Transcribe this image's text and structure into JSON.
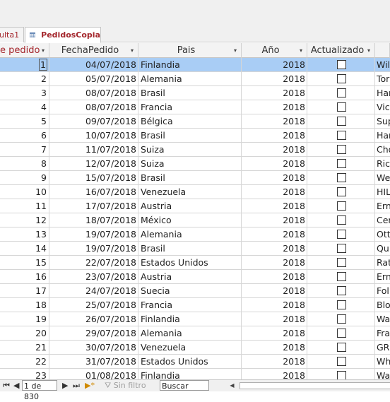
{
  "tabs": [
    {
      "label": "ulta1"
    },
    {
      "label": "PedidosCopia"
    }
  ],
  "columns": {
    "id": "e pedido",
    "fecha": "FechaPedido",
    "pais": "Pais",
    "anio": "Año",
    "actualizado": "Actualizado"
  },
  "rows": [
    {
      "id": "1",
      "fecha": "04/07/2018",
      "pais": "Finlandia",
      "anio": "2018",
      "extra": "Wil"
    },
    {
      "id": "2",
      "fecha": "05/07/2018",
      "pais": "Alemania",
      "anio": "2018",
      "extra": "Tor"
    },
    {
      "id": "3",
      "fecha": "08/07/2018",
      "pais": "Brasil",
      "anio": "2018",
      "extra": "Har"
    },
    {
      "id": "4",
      "fecha": "08/07/2018",
      "pais": "Francia",
      "anio": "2018",
      "extra": "Vic"
    },
    {
      "id": "5",
      "fecha": "09/07/2018",
      "pais": "Bélgica",
      "anio": "2018",
      "extra": "Sup"
    },
    {
      "id": "6",
      "fecha": "10/07/2018",
      "pais": "Brasil",
      "anio": "2018",
      "extra": "Har"
    },
    {
      "id": "7",
      "fecha": "11/07/2018",
      "pais": "Suiza",
      "anio": "2018",
      "extra": "Cho"
    },
    {
      "id": "8",
      "fecha": "12/07/2018",
      "pais": "Suiza",
      "anio": "2018",
      "extra": "Ric"
    },
    {
      "id": "9",
      "fecha": "15/07/2018",
      "pais": "Brasil",
      "anio": "2018",
      "extra": "We"
    },
    {
      "id": "10",
      "fecha": "16/07/2018",
      "pais": "Venezuela",
      "anio": "2018",
      "extra": "HIL"
    },
    {
      "id": "11",
      "fecha": "17/07/2018",
      "pais": "Austria",
      "anio": "2018",
      "extra": "Ern"
    },
    {
      "id": "12",
      "fecha": "18/07/2018",
      "pais": "México",
      "anio": "2018",
      "extra": "Cer"
    },
    {
      "id": "13",
      "fecha": "19/07/2018",
      "pais": "Alemania",
      "anio": "2018",
      "extra": "Ott"
    },
    {
      "id": "14",
      "fecha": "19/07/2018",
      "pais": "Brasil",
      "anio": "2018",
      "extra": "Qu"
    },
    {
      "id": "15",
      "fecha": "22/07/2018",
      "pais": "Estados Unidos",
      "anio": "2018",
      "extra": "Rat"
    },
    {
      "id": "16",
      "fecha": "23/07/2018",
      "pais": "Austria",
      "anio": "2018",
      "extra": "Ern"
    },
    {
      "id": "17",
      "fecha": "24/07/2018",
      "pais": "Suecia",
      "anio": "2018",
      "extra": "Fol"
    },
    {
      "id": "18",
      "fecha": "25/07/2018",
      "pais": "Francia",
      "anio": "2018",
      "extra": "Blo"
    },
    {
      "id": "19",
      "fecha": "26/07/2018",
      "pais": "Finlandia",
      "anio": "2018",
      "extra": "Wa"
    },
    {
      "id": "20",
      "fecha": "29/07/2018",
      "pais": "Alemania",
      "anio": "2018",
      "extra": "Fra"
    },
    {
      "id": "21",
      "fecha": "30/07/2018",
      "pais": "Venezuela",
      "anio": "2018",
      "extra": "GRO"
    },
    {
      "id": "22",
      "fecha": "31/07/2018",
      "pais": "Estados Unidos",
      "anio": "2018",
      "extra": "Wh"
    },
    {
      "id": "23",
      "fecha": "01/08/2018",
      "pais": "Finlandia",
      "anio": "2018",
      "extra": "Wa"
    }
  ],
  "navigation": {
    "record_position": "1 de 830",
    "filter_label": "Sin filtro",
    "search_placeholder": "Buscar"
  },
  "colors": {
    "selected_row": "#a9cdf5",
    "tab_text": "#a4262c"
  }
}
